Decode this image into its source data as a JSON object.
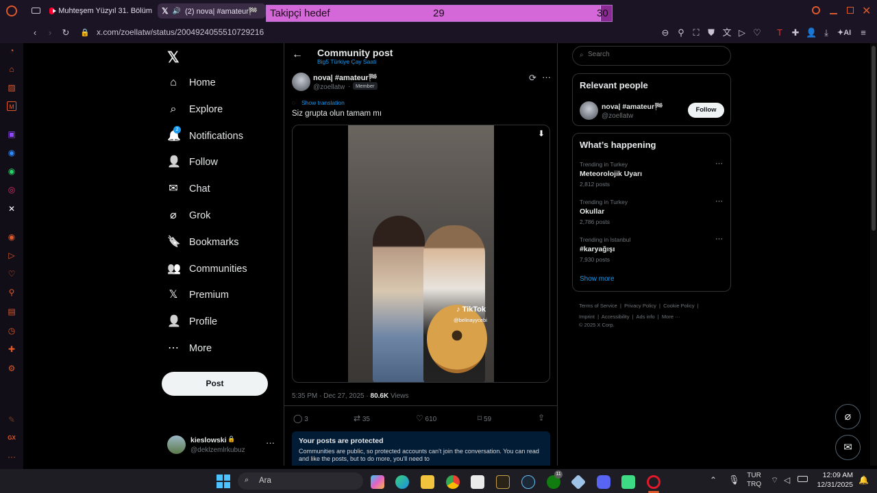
{
  "browser": {
    "tabs": [
      {
        "title": "Muhteşem Yüzyıl 31. Bölüm",
        "active": false
      },
      {
        "title": "(2) nova| #amateur🏁",
        "active": true
      }
    ],
    "url": "x.com/zoellatw/status/2004924055510729216",
    "ai_label": "AI"
  },
  "overlay": {
    "label": "Takipçi hedef",
    "current": "29",
    "target": "30",
    "progress": 0.967
  },
  "x_nav": {
    "items": [
      {
        "label": "Home",
        "icon": "home-icon"
      },
      {
        "label": "Explore",
        "icon": "search-icon"
      },
      {
        "label": "Notifications",
        "icon": "bell-icon",
        "badge": "2"
      },
      {
        "label": "Follow",
        "icon": "follow-icon"
      },
      {
        "label": "Chat",
        "icon": "mail-icon"
      },
      {
        "label": "Grok",
        "icon": "grok-icon"
      },
      {
        "label": "Bookmarks",
        "icon": "bookmark-icon"
      },
      {
        "label": "Communities",
        "icon": "communities-icon"
      },
      {
        "label": "Premium",
        "icon": "x-icon"
      },
      {
        "label": "Profile",
        "icon": "person-icon"
      },
      {
        "label": "More",
        "icon": "more-circle-icon"
      }
    ],
    "post_button": "Post",
    "account": {
      "name": "kieslowski",
      "handle": "@deklzemlrkubuz"
    }
  },
  "header": {
    "title": "Community post",
    "subtitle": "Big5 Türkiye Çay Saati"
  },
  "post": {
    "author": "nova| #amateur🏁",
    "handle": "@zoellatw",
    "separator": "·",
    "badge": "Member",
    "show_translation": "Show translation",
    "text": "Siz grupta olun tamam mı",
    "tiktok_label": "TikTok",
    "tiktok_handle": "@belinayycebi",
    "time": "5:35 PM · Dec 27, 2025 ·",
    "views_count": "80.6K",
    "views_label": "Views",
    "replies": "3",
    "reposts": "35",
    "likes": "610",
    "bookmarks": "59"
  },
  "protected": {
    "title": "Your posts are protected",
    "body": "Communities are public, so protected accounts can't join the conversation. You can read and like the posts, but to do more, you'll need to"
  },
  "search": {
    "placeholder": "Search"
  },
  "relevant": {
    "title": "Relevant people",
    "name": "nova| #amateur🏁",
    "handle": "@zoellatw",
    "follow": "Follow"
  },
  "happening": {
    "title": "What’s happening",
    "trends": [
      {
        "context": "Trending in Turkey",
        "topic": "Meteorolojik Uyarı",
        "posts": "2,812 posts"
      },
      {
        "context": "Trending in Turkey",
        "topic": "Okullar",
        "posts": "2,786 posts"
      },
      {
        "context": "Trending in Istanbul",
        "topic": "#karyağışı",
        "posts": "7,930 posts"
      }
    ],
    "show_more": "Show more"
  },
  "footer": {
    "links": [
      "Terms of Service",
      "Privacy Policy",
      "Cookie Policy",
      "Imprint",
      "Accessibility",
      "Ads info",
      "More ···"
    ],
    "copyright": "© 2025 X Corp."
  },
  "taskbar": {
    "search_placeholder": "Ara",
    "lang_top": "TUR",
    "lang_bottom": "TRQ",
    "time": "12:09 AM",
    "date": "12/31/2025",
    "xbox_badge": "11"
  },
  "colors": {
    "accent": "#1d9bf0",
    "opera": "#e0592a",
    "overlay": "#d468d8"
  }
}
